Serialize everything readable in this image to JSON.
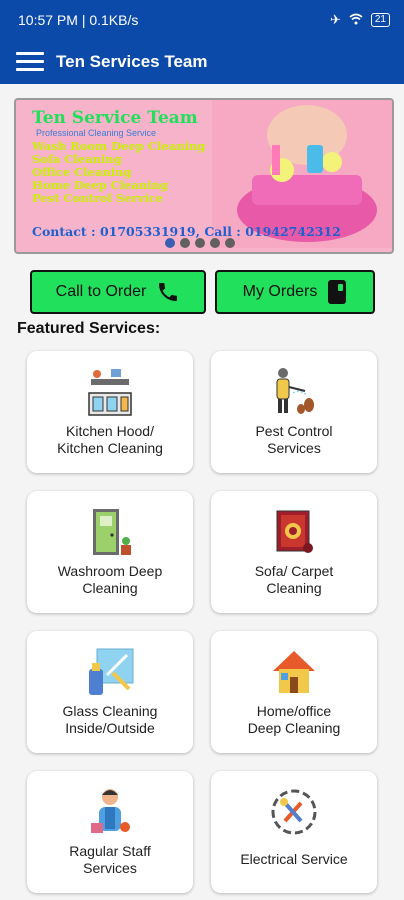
{
  "status_bar": {
    "time": "10:57 PM | 0.1KB/s",
    "battery": "21"
  },
  "app_bar": {
    "title": "Ten Services Team"
  },
  "banner": {
    "title": "Ten Service Team",
    "subtitle": "Professional Cleaning Service",
    "services": [
      "Wash Room Deep Cleaning",
      "Sofa Cleaning",
      "Office Cleaning",
      "Home Deep Cleaning",
      "Pest Control Service"
    ],
    "contact": "Contact : 01705331919, Call : 01942742312"
  },
  "buttons": {
    "call": "Call to Order",
    "orders": "My Orders"
  },
  "section_title": "Featured Services:",
  "services": [
    {
      "label": "Kitchen Hood/\nKitchen Cleaning",
      "icon": "kitchen-icon"
    },
    {
      "label": "Pest Control\nServices",
      "icon": "pest-control-icon"
    },
    {
      "label": "Washroom Deep\nCleaning",
      "icon": "washroom-icon"
    },
    {
      "label": "Sofa/ Carpet\nCleaning",
      "icon": "carpet-icon"
    },
    {
      "label": "Glass Cleaning\nInside/Outside",
      "icon": "glass-cleaning-icon"
    },
    {
      "label": "Home/office\nDeep Cleaning",
      "icon": "home-icon"
    },
    {
      "label": "Ragular Staff\nServices",
      "icon": "staff-icon"
    },
    {
      "label": "Electrical Service",
      "icon": "electrical-icon"
    }
  ],
  "colors": {
    "primary": "#0b4aa8",
    "button": "#21e05c",
    "banner_bg": "#f6b3c9"
  }
}
